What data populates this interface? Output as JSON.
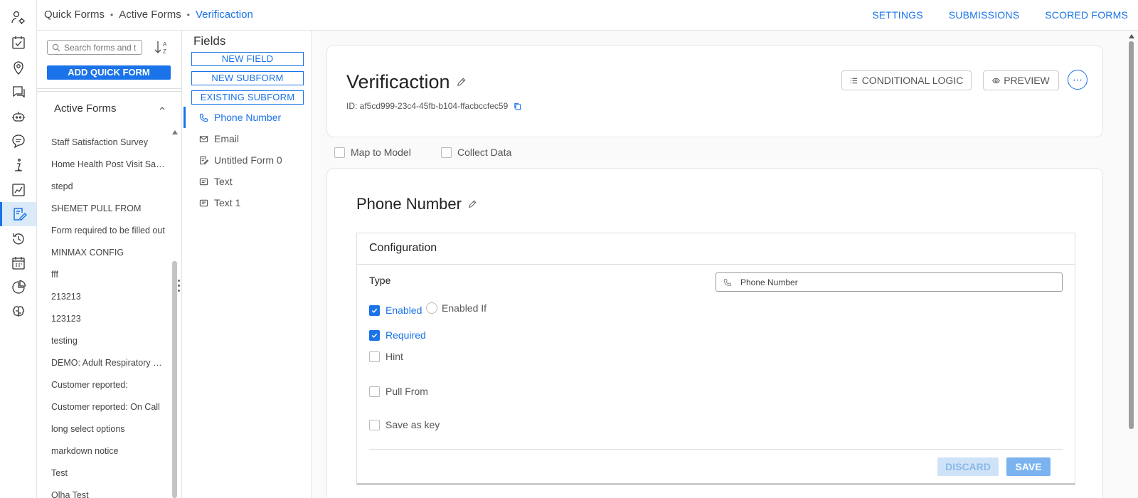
{
  "breadcrumb": {
    "items": [
      "Quick Forms",
      "Active Forms"
    ],
    "separator": "•",
    "current": "Verificaction"
  },
  "top_nav": {
    "settings": "SETTINGS",
    "submissions": "SUBMISSIONS",
    "scored_forms": "SCORED FORMS"
  },
  "rail": {
    "icons": [
      "user-settings-icon",
      "task-check-icon",
      "location-pin-icon",
      "chat-flag-icon",
      "robot-icon",
      "comment-icon",
      "info-icon",
      "report-chart-icon",
      "form-edit-icon",
      "history-icon",
      "calendar-icon",
      "pie-chart-icon",
      "brain-icon"
    ],
    "active_index": 8
  },
  "forms_panel": {
    "search_placeholder": "Search forms and t",
    "add_button": "ADD QUICK FORM",
    "section_title": "Active Forms",
    "items": [
      "Staff Satisfaction Survey",
      "Home Health Post Visit Satisfaction",
      "stepd",
      "SHEMET PULL FROM",
      "Form required to be filled out",
      "MINMAX CONFIG",
      "fff",
      "213213",
      "123123",
      "testing",
      "DEMO: Adult Respiratory Screening",
      "Customer reported:",
      "Customer reported: On Call",
      "long select options",
      "markdown notice",
      "Test",
      "Olha Test"
    ]
  },
  "fields_panel": {
    "title": "Fields",
    "new_field": "NEW FIELD",
    "new_subform": "NEW SUBFORM",
    "existing_subform": "EXISTING SUBFORM",
    "fields": [
      {
        "label": "Phone Number",
        "icon": "phone-icon",
        "active": true
      },
      {
        "label": "Email",
        "icon": "email-icon",
        "active": false
      },
      {
        "label": "Untitled Form 0",
        "icon": "subform-icon",
        "active": false
      },
      {
        "label": "Text",
        "icon": "text-field-icon",
        "active": false
      },
      {
        "label": "Text 1",
        "icon": "text-field-icon",
        "active": false
      }
    ]
  },
  "form_header": {
    "title": "Verificaction",
    "id_text": "ID: af5cd999-23c4-45fb-b104-ffacbccfec59",
    "conditional_logic": "CONDITIONAL LOGIC",
    "preview": "PREVIEW",
    "more": "⋯"
  },
  "form_options": {
    "map_to_model": "Map to Model",
    "collect_data": "Collect Data"
  },
  "field_editor": {
    "title": "Phone Number",
    "configuration": "Configuration",
    "type_label": "Type",
    "type_value": "Phone Number",
    "enabled": "Enabled",
    "enabled_if": "Enabled If",
    "required": "Required",
    "hint": "Hint",
    "pull_from": "Pull From",
    "save_as_key": "Save as key",
    "discard": "DISCARD",
    "save": "SAVE"
  },
  "colors": {
    "accent": "#1a73e8",
    "active_bg": "#dbeaf9"
  }
}
